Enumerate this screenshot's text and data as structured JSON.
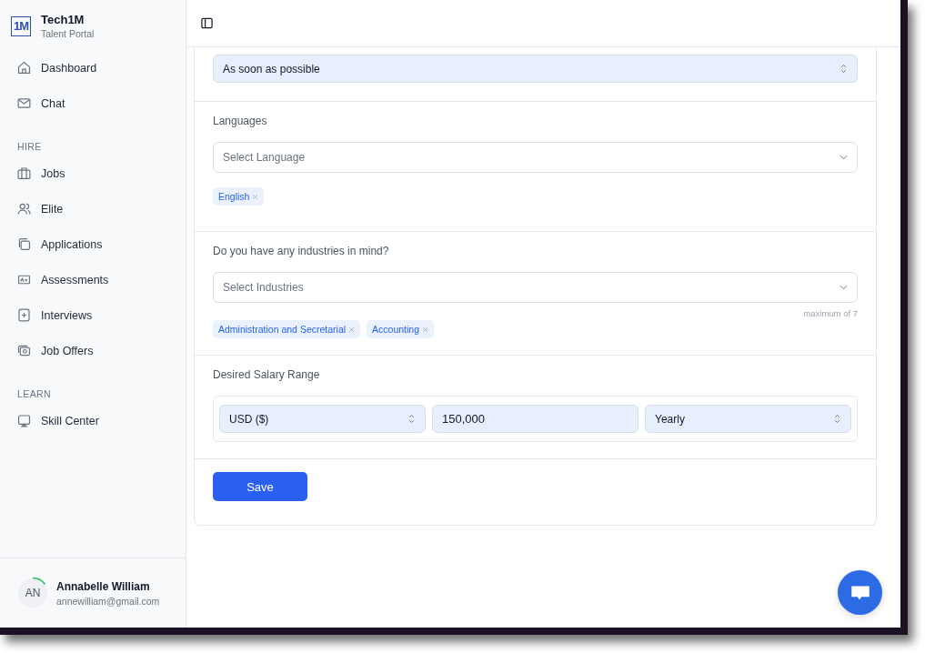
{
  "brand": {
    "name": "Tech1M",
    "subtitle": "Talent Portal",
    "logo_text": "1M"
  },
  "sidebar": {
    "sections": [
      {
        "items": [
          {
            "label": "Dashboard",
            "selected": false
          },
          {
            "label": "Chat",
            "selected": false
          }
        ]
      },
      {
        "heading": "HIRE",
        "items": [
          {
            "label": "Jobs",
            "selected": false
          },
          {
            "label": "Elite",
            "selected": false
          },
          {
            "label": "Applications",
            "selected": false
          },
          {
            "label": "Assessments",
            "selected": false
          },
          {
            "label": "Interviews",
            "selected": false
          },
          {
            "label": "Job Offers",
            "selected": false
          }
        ]
      },
      {
        "heading": "LEARN",
        "items": [
          {
            "label": "Skill Center",
            "selected": false
          }
        ]
      }
    ]
  },
  "user": {
    "initials": "AN",
    "name": "Annabelle William",
    "email": "annewilliam@gmail.com",
    "level": 0.15
  },
  "form": {
    "availability": {
      "value": "As soon as possible"
    },
    "languages": {
      "label": "Languages",
      "placeholder": "Select Language",
      "chips": [
        "English"
      ]
    },
    "industries": {
      "label": "Do you have any industries in mind?",
      "placeholder": "Select Industries",
      "hint": "maximum of 7",
      "chips": [
        "Administration and Secretarial",
        "Accounting"
      ]
    },
    "salary": {
      "label": "Desired Salary Range",
      "currency": "USD ($)",
      "amount": "150,000",
      "period": "Yearly"
    },
    "save": "Save"
  }
}
